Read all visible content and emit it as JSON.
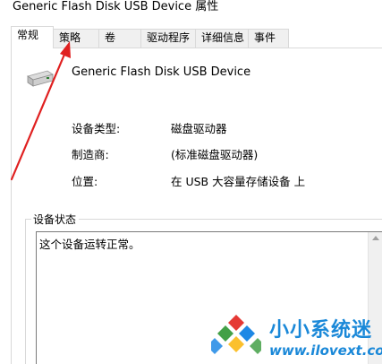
{
  "window": {
    "title": "Generic Flash Disk USB Device 属性"
  },
  "tabs": [
    {
      "label": "常规",
      "active": true
    },
    {
      "label": "策略",
      "active": false
    },
    {
      "label": "卷",
      "active": false
    },
    {
      "label": "驱动程序",
      "active": false
    },
    {
      "label": "详细信息",
      "active": false
    },
    {
      "label": "事件",
      "active": false
    }
  ],
  "device": {
    "name": "Generic Flash Disk USB Device",
    "icon": "usb-drive-icon"
  },
  "properties": [
    {
      "label": "设备类型:",
      "value": "磁盘驱动器"
    },
    {
      "label": "制造商:",
      "value": "(标准磁盘驱动器)"
    },
    {
      "label": "位置:",
      "value": "在 USB 大容量存储设备 上"
    }
  ],
  "device_status": {
    "title": "设备状态",
    "text": "这个设备运转正常。"
  },
  "watermark": {
    "brand": "小小系统迷",
    "url": "www.ilovext.com"
  },
  "colors": {
    "arrow": "#e02020",
    "watermark": "#1a88d8"
  }
}
